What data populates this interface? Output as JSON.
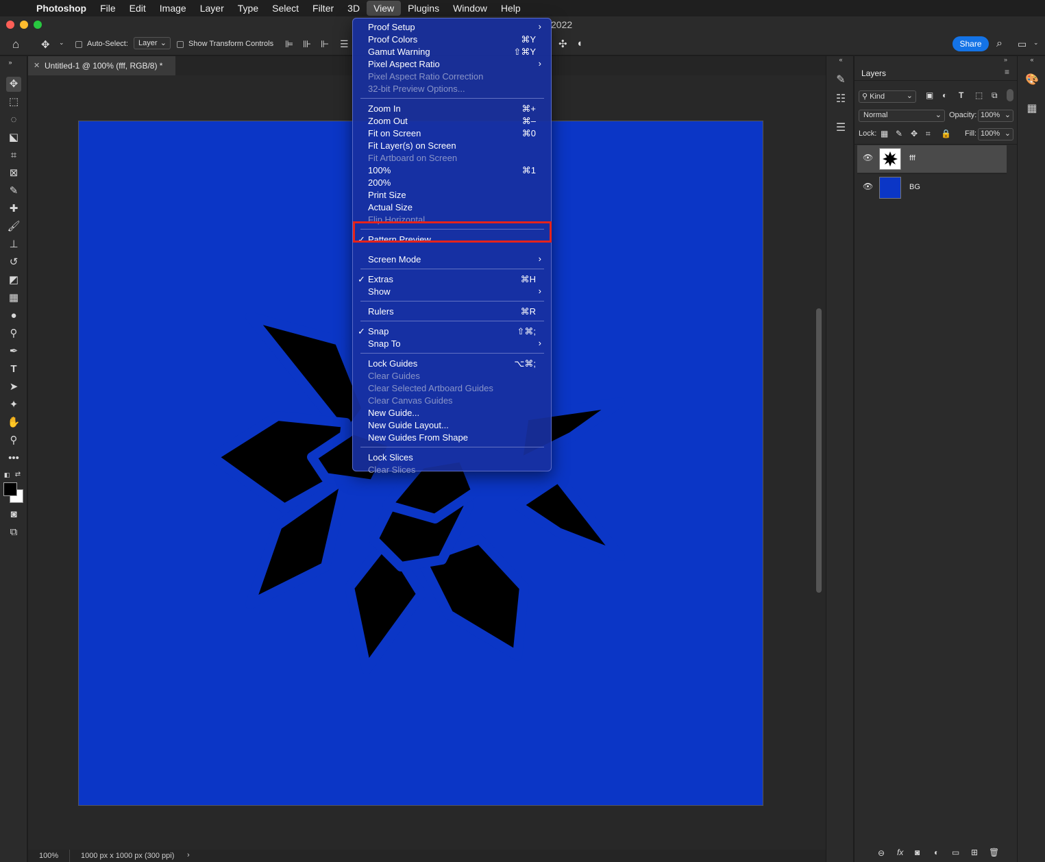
{
  "menubar": {
    "items": [
      "Photoshop",
      "File",
      "Edit",
      "Image",
      "Layer",
      "Type",
      "Select",
      "Filter",
      "3D",
      "View",
      "Plugins",
      "Window",
      "Help"
    ],
    "active": "View"
  },
  "window": {
    "title_fragment": "2022"
  },
  "options_bar": {
    "auto_select_label": "Auto-Select:",
    "auto_select_value": "Layer",
    "show_transform_label": "Show Transform Controls",
    "share_label": "Share"
  },
  "document": {
    "tab_title": "Untitled-1 @ 100% (fff, RGB/8) *",
    "canvas_color": "#0b36c6"
  },
  "status_bar": {
    "zoom": "100%",
    "doc_info": "1000 px x 1000 px (300 ppi)"
  },
  "layers_panel": {
    "title": "Layers",
    "filter_kind": "Kind",
    "blend_mode": "Normal",
    "opacity_label": "Opacity:",
    "opacity_value": "100%",
    "lock_label": "Lock:",
    "fill_label": "Fill:",
    "fill_value": "100%",
    "layers": [
      {
        "name": "fff",
        "selected": true
      },
      {
        "name": "BG",
        "selected": false,
        "color": "#0b36c6"
      }
    ]
  },
  "view_menu": {
    "highlight_color": "#e6231b",
    "items": [
      {
        "label": "Proof Setup",
        "shortcut": "",
        "submenu": true,
        "disabled": false,
        "checked": false
      },
      {
        "label": "Proof Colors",
        "shortcut": "⌘Y",
        "submenu": false,
        "disabled": false,
        "checked": false
      },
      {
        "label": "Gamut Warning",
        "shortcut": "⇧⌘Y",
        "submenu": false,
        "disabled": false,
        "checked": false
      },
      {
        "label": "Pixel Aspect Ratio",
        "shortcut": "",
        "submenu": true,
        "disabled": false,
        "checked": false
      },
      {
        "label": "Pixel Aspect Ratio Correction",
        "shortcut": "",
        "submenu": false,
        "disabled": true,
        "checked": false
      },
      {
        "label": "32-bit Preview Options...",
        "shortcut": "",
        "submenu": false,
        "disabled": true,
        "checked": false
      },
      {
        "label": "Zoom In",
        "shortcut": "⌘+",
        "submenu": false,
        "disabled": false,
        "checked": false
      },
      {
        "label": "Zoom Out",
        "shortcut": "⌘–",
        "submenu": false,
        "disabled": false,
        "checked": false
      },
      {
        "label": "Fit on Screen",
        "shortcut": "⌘0",
        "submenu": false,
        "disabled": false,
        "checked": false
      },
      {
        "label": "Fit Layer(s) on Screen",
        "shortcut": "",
        "submenu": false,
        "disabled": false,
        "checked": false
      },
      {
        "label": "Fit Artboard on Screen",
        "shortcut": "",
        "submenu": false,
        "disabled": true,
        "checked": false
      },
      {
        "label": "100%",
        "shortcut": "⌘1",
        "submenu": false,
        "disabled": false,
        "checked": false
      },
      {
        "label": "200%",
        "shortcut": "",
        "submenu": false,
        "disabled": false,
        "checked": false
      },
      {
        "label": "Print Size",
        "shortcut": "",
        "submenu": false,
        "disabled": false,
        "checked": false
      },
      {
        "label": "Actual Size",
        "shortcut": "",
        "submenu": false,
        "disabled": false,
        "checked": false
      },
      {
        "label": "Flip Horizontal",
        "shortcut": "",
        "submenu": false,
        "disabled": true,
        "checked": false
      },
      {
        "label": "Pattern Preview",
        "shortcut": "",
        "submenu": false,
        "disabled": false,
        "checked": true
      },
      {
        "label": "Screen Mode",
        "shortcut": "",
        "submenu": true,
        "disabled": false,
        "checked": false
      },
      {
        "label": "Extras",
        "shortcut": "⌘H",
        "submenu": false,
        "disabled": false,
        "checked": true
      },
      {
        "label": "Show",
        "shortcut": "",
        "submenu": true,
        "disabled": false,
        "checked": false
      },
      {
        "label": "Rulers",
        "shortcut": "⌘R",
        "submenu": false,
        "disabled": false,
        "checked": false
      },
      {
        "label": "Snap",
        "shortcut": "⇧⌘;",
        "submenu": false,
        "disabled": false,
        "checked": true
      },
      {
        "label": "Snap To",
        "shortcut": "",
        "submenu": true,
        "disabled": false,
        "checked": false
      },
      {
        "label": "Lock Guides",
        "shortcut": "⌥⌘;",
        "submenu": false,
        "disabled": false,
        "checked": false
      },
      {
        "label": "Clear Guides",
        "shortcut": "",
        "submenu": false,
        "disabled": true,
        "checked": false
      },
      {
        "label": "Clear Selected Artboard Guides",
        "shortcut": "",
        "submenu": false,
        "disabled": true,
        "checked": false
      },
      {
        "label": "Clear Canvas Guides",
        "shortcut": "",
        "submenu": false,
        "disabled": true,
        "checked": false
      },
      {
        "label": "New Guide...",
        "shortcut": "",
        "submenu": false,
        "disabled": false,
        "checked": false
      },
      {
        "label": "New Guide Layout...",
        "shortcut": "",
        "submenu": false,
        "disabled": false,
        "checked": false
      },
      {
        "label": "New Guides From Shape",
        "shortcut": "",
        "submenu": false,
        "disabled": false,
        "checked": false
      },
      {
        "label": "Lock Slices",
        "shortcut": "",
        "submenu": false,
        "disabled": false,
        "checked": false
      },
      {
        "label": "Clear Slices",
        "shortcut": "",
        "submenu": false,
        "disabled": true,
        "checked": false
      }
    ]
  }
}
